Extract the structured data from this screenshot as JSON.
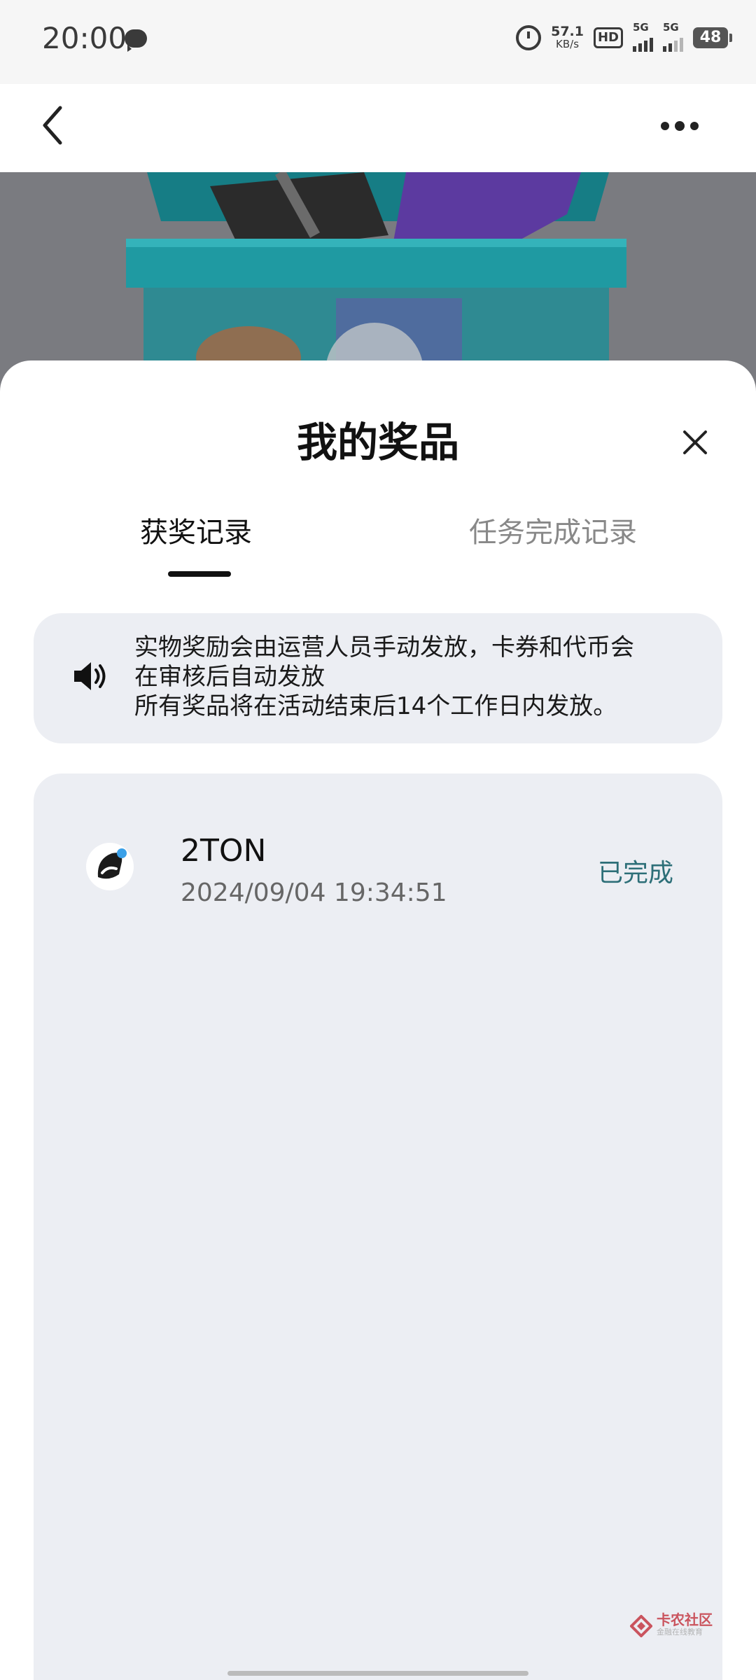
{
  "status_bar": {
    "time": "20:00",
    "net_speed_value": "57.1",
    "net_speed_unit": "KB/s",
    "hd_label": "HD",
    "sim1_label": "5G",
    "sim2_label": "5G",
    "battery": "48"
  },
  "nav": {
    "back_icon": "chevron-left-icon",
    "more_icon": "more-dots-icon"
  },
  "sheet": {
    "title": "我的奖品",
    "close_icon": "close-icon",
    "tabs": [
      {
        "label": "获奖记录",
        "active": true
      },
      {
        "label": "任务完成记录",
        "active": false
      }
    ],
    "notice": {
      "icon": "speaker-icon",
      "lines": [
        "实物奖励会由运营人员手动发放，卡券和代币会",
        "在审核后自动发放",
        "所有奖品将在活动结束后14个工作日内发放。"
      ]
    },
    "prizes": [
      {
        "name": "2TON",
        "time": "2024/09/04 19:34:51",
        "status": "已完成",
        "icon": "ton-token-icon"
      }
    ]
  },
  "watermark": {
    "main": "卡农社区",
    "sub": "金融在线教育"
  },
  "colors": {
    "status_done": "#2d6f78",
    "panel_bg": "#eceef3",
    "banner_bg": "#7a7b80",
    "box_teal": "#1f8f97"
  }
}
